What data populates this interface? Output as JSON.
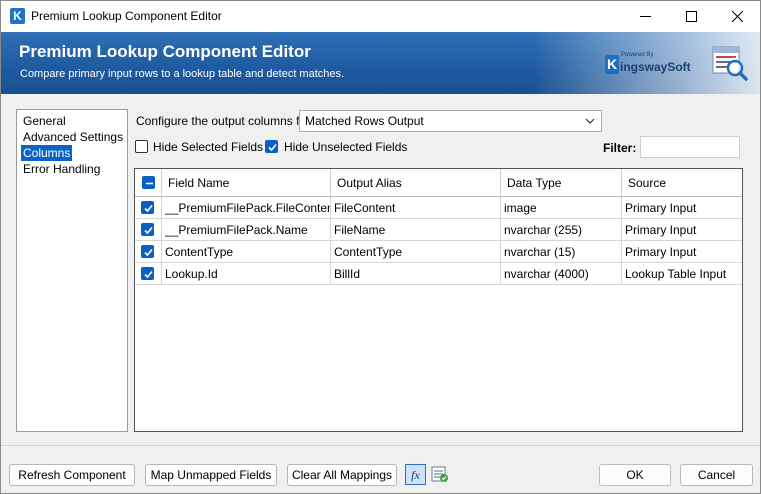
{
  "window": {
    "title": "Premium Lookup Component Editor",
    "app_icon_letter": "K"
  },
  "banner": {
    "title": "Premium Lookup Component Editor",
    "subtitle": "Compare primary input rows to a lookup table and detect matches.",
    "brand_powered": "Powered By",
    "brand_letter": "K",
    "brand_name": "ingswaySoft"
  },
  "nav": {
    "items": [
      {
        "label": "General"
      },
      {
        "label": "Advanced Settings"
      },
      {
        "label": "Columns",
        "selected": true
      },
      {
        "label": "Error Handling"
      }
    ]
  },
  "config": {
    "label": "Configure the output columns for",
    "selected_output": "Matched Rows Output"
  },
  "options": {
    "hide_selected_label": "Hide Selected Fields",
    "hide_selected_checked": false,
    "hide_unselected_label": "Hide Unselected Fields",
    "hide_unselected_checked": true,
    "filter_label": "Filter:",
    "filter_value": ""
  },
  "grid": {
    "headers": [
      "Field Name",
      "Output Alias",
      "Data Type",
      "Source"
    ],
    "rows": [
      {
        "checked": true,
        "field": "__PremiumFilePack.FileContent",
        "alias": "FileContent",
        "type": "image",
        "source": "Primary Input"
      },
      {
        "checked": true,
        "field": "__PremiumFilePack.Name",
        "alias": "FileName",
        "type": "nvarchar (255)",
        "source": "Primary Input"
      },
      {
        "checked": true,
        "field": "ContentType",
        "alias": "ContentType",
        "type": "nvarchar (15)",
        "source": "Primary Input"
      },
      {
        "checked": true,
        "field": "Lookup.Id",
        "alias": "BillId",
        "type": "nvarchar (4000)",
        "source": "Lookup Table Input"
      }
    ]
  },
  "footer": {
    "refresh_label": "Refresh Component",
    "map_unmapped_label": "Map Unmapped Fields",
    "clear_mappings_label": "Clear All Mappings",
    "ok_label": "OK",
    "cancel_label": "Cancel"
  },
  "colors": {
    "banner": "#1f5aa0",
    "accent": "#0a5fc6",
    "selection": "#0a64c8"
  }
}
